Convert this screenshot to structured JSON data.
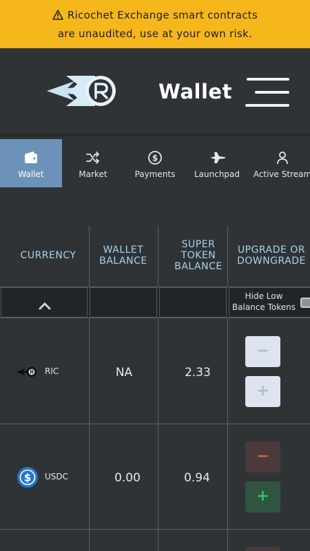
{
  "banner": {
    "line1": "Ricochet Exchange smart contracts",
    "line2": "are unaudited, use at your own risk.",
    "icon": "warning-icon"
  },
  "header": {
    "title": "Wallet",
    "logo_icon": "ricochet-logo",
    "menu_icon": "hamburger-menu-icon"
  },
  "tabs": [
    {
      "label": "Wallet",
      "icon": "wallet-icon",
      "active": true
    },
    {
      "label": "Market",
      "icon": "shuffle-icon",
      "active": false
    },
    {
      "label": "Payments",
      "icon": "dollar-circle-icon",
      "active": false
    },
    {
      "label": "Launchpad",
      "icon": "jet-icon",
      "active": false
    },
    {
      "label": "Active Stream",
      "icon": "user-icon",
      "active": false
    }
  ],
  "table": {
    "headers": {
      "currency": "CURRENCY",
      "wallet_balance": [
        "WALLET",
        "BALANCE"
      ],
      "super_token_balance": [
        "SUPER",
        "TOKEN",
        "BALANCE"
      ],
      "upgrade": [
        "UPGRADE OR",
        "DOWNGRADE"
      ]
    },
    "filter": {
      "hide_low_line1": "Hide Low",
      "hide_low_line2": "Balance Tokens",
      "toggle_checked": false
    },
    "rows": [
      {
        "currency": "RIC",
        "wallet_balance": "NA",
        "super_token_balance": "2.33",
        "minus": "−",
        "plus": "+"
      },
      {
        "currency": "USDC",
        "wallet_balance": "0.00",
        "super_token_balance": "0.94",
        "minus": "−",
        "plus": "+"
      }
    ]
  },
  "colors": {
    "banner": "#f5b71c",
    "background": "#2f3336",
    "active_tab": "#6d92b9",
    "header_text": "#a9d3e8",
    "minus_red": "#e05a3c",
    "plus_green": "#33c26a"
  }
}
